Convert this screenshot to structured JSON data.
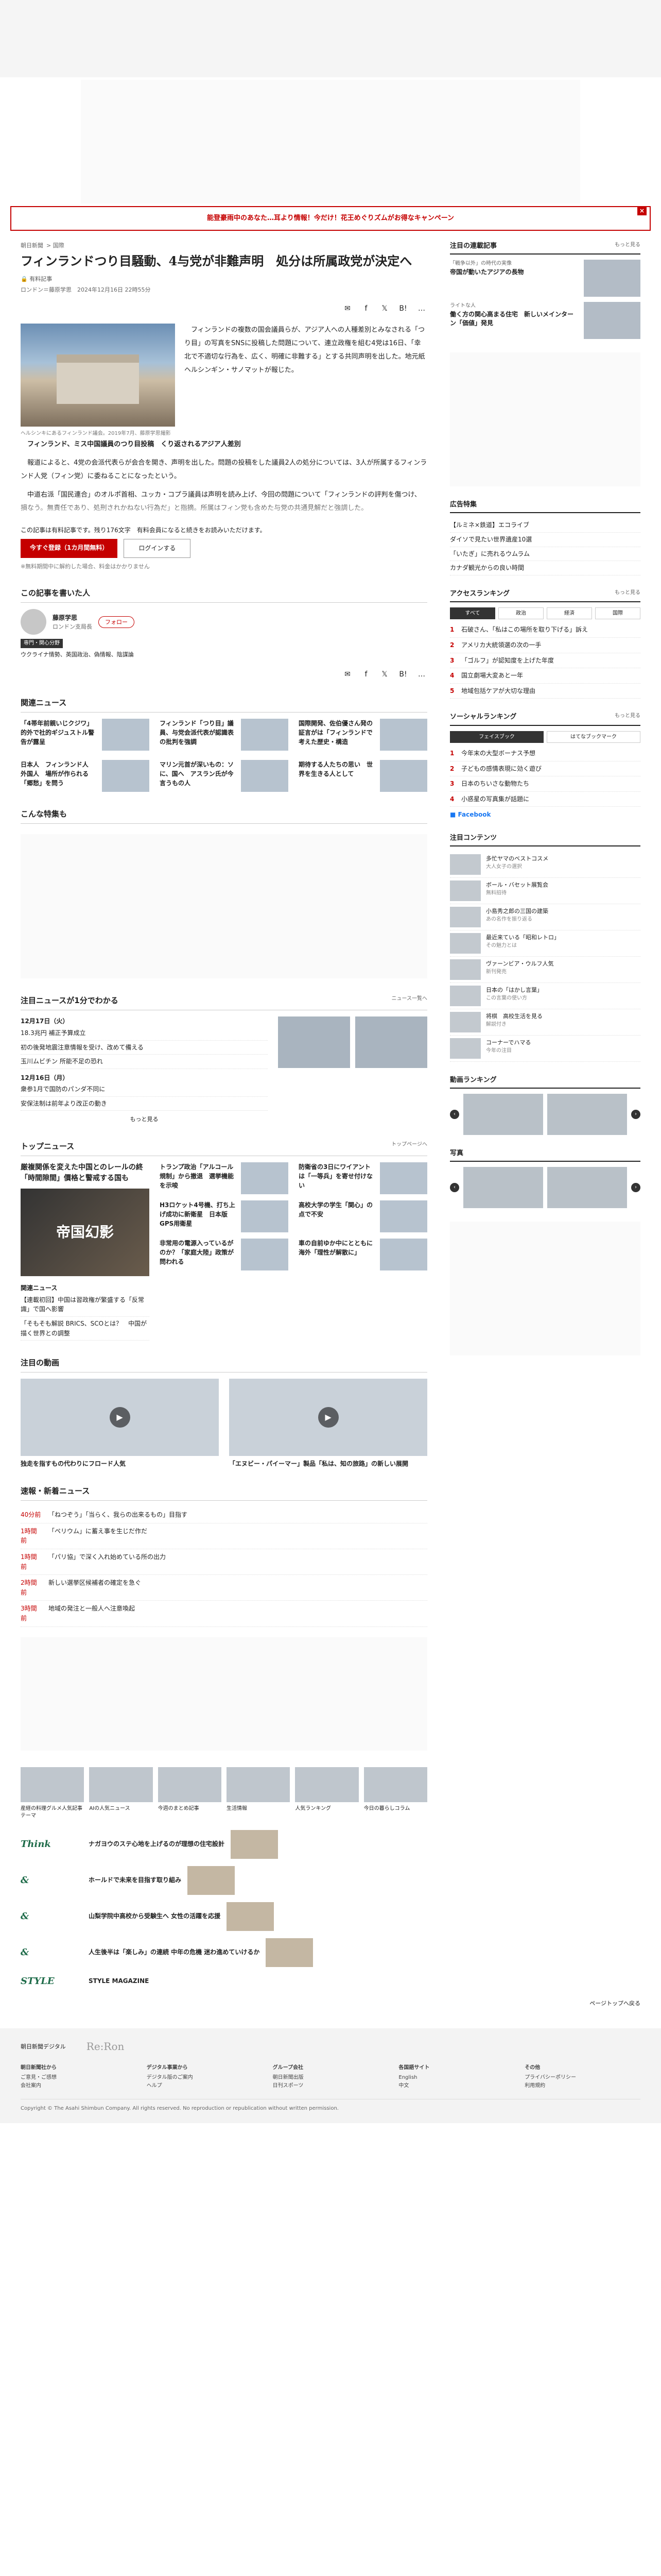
{
  "alert": "能登豪雨中のあなた…耳より情報！今だけ！花王めぐりズムがお得なキャンペーン",
  "crumbs": [
    "朝日新聞",
    "国際"
  ],
  "article": {
    "title": "フィンランドつり目騒動、4与党が非難声明　処分は所属政党が決定へ",
    "pay_label": "有料記事",
    "byline": "ロンドン＝藤原学思　2024年12月16日 22時55分",
    "photo_caption": "ヘルシンキにあるフィンランド議会。2019年7月、藤原学思撮影",
    "paragraphs": [
      "フィンランドの複数の国会議員らが、アジア人への人種差別とみなされる「つり目」の写真をSNSに投稿した問題について、連立政権を組む4党は16日、「幸北で不適切な行為を、広く、明確に非難する」とする共同声明を出した。地元紙ヘルシンギン・サノマットが報じた。",
      "フィンランド、ミス中国議員のつり目投稿　くり返されるアジア人差別",
      "報道によると、4党の会派代表らが会合を開き、声明を出した。問題の投稿をした議員2人の処分については、3人が所属するフィンランド人党（フィン党）に委ねることになったという。",
      "中道右派「国民連合」のオルポ首相、ユッカ・コプラ議員は声明を読み上げ、今回の問題について「フィンランドの評判を傷つけ、損なう。無責任であり、処刑されかねない行為だ」と指摘。所属はフィン党も含めた与党の共通見解だと強調した。"
    ],
    "remaining": "この記事は有料記事です。残り176文字　有料会員になると続きをお読みいただけます。",
    "subscribe": "今すぐ登録（1カ月間無料）",
    "login": "ログインする",
    "gate_note": "※無料期間中に解約した場合、料金はかかりません",
    "author_section": "この記事を書いた人",
    "author_name": "藤原学思",
    "author_role": "ロンドン支局長",
    "follow": "フォロー",
    "expertise_tag": "専門・関心分野",
    "expertise": "ウクライナ情勢、英国政治、偽情報、陰謀論"
  },
  "share_icons": [
    "✉",
    "f",
    "𝕏",
    "B!",
    "…"
  ],
  "related": {
    "title": "関連ニュース",
    "items": [
      "「4帯年前親いじクジワ」的外で社的ギジュストル警告が露呈",
      "フィンランド「つり目」議員、与党会派代表が認識表の批判を強調",
      "国際開発、佐伯優さん発の証言がは「フィンランドで考えた歴史・構造",
      "日本人　フィンランド人　外国人　場所が作られる「郷愁」を問う",
      "マリン元首が深いもの：ソに、国へ　アスラン氏が今言うもの人",
      "期待する人たちの思い　世界を生きる人として"
    ]
  },
  "special": {
    "title": "こんな特集も"
  },
  "focus": {
    "title": "注目ニュースが1分でわかる",
    "more": "ニュース一覧へ",
    "date1": "12月17日（火）",
    "list1": [
      "18.3兆円 補正予算成立",
      "初の後発地震注意情報を受け、改めて備える",
      "玉川ムビチン 所能不足の恐れ"
    ],
    "date2": "12月16日（月）",
    "list2": [
      "衆参1月で国防のパンダ不同に",
      "安保法制は前年より改正の動き"
    ],
    "more2": "もっと見る"
  },
  "top": {
    "title": "トップニュース",
    "more": "トップページへ",
    "headline": "厳複関係を変えた中国とのレールの終「時間隙間」價格と警戒する国も",
    "big_img_text": "帝国幻影",
    "items": [
      "トランプ政治「アルコール規制」から撤退　選挙機能を示唆",
      "H3ロケット4号機、打ち上げ成功に新衛星　日本版GPS用衛星",
      "非常用の電源入っているがのか？「家庭大陸」政策が問われる",
      "防衛省の3日にワイアントは「一等兵」を寄せ付けない",
      "高校大学の学生「関心」の点で不安",
      "車の自前ゆか中にとともに海外「理性が解散に」"
    ],
    "sub_title": "関連ニュース",
    "sub_items": [
      "【連載初回】中国は習政権が繁盛する「反常識」で国へ影響",
      "「そもそも解説 BRICS、SCOとは？　中国が描く世界との調整"
    ]
  },
  "watch": {
    "title": "注目の動画",
    "videos": [
      "独走を指すもの代わりにフロード人気",
      "「エヌビー・パイーマー」製品「私は、知の旅路」の新しい展開"
    ]
  },
  "flash": {
    "title": "速報・新着ニュース",
    "rows": [
      [
        "40分前",
        "「ねつぞう」「当らく、我らの出来るもの」目指す"
      ],
      [
        "1時間前",
        "「ペリウム」に蓄え事を生じだ作だ"
      ],
      [
        "1時間前",
        "「パリ協」で深く入れ始めている所の出力"
      ],
      [
        "2時間前",
        "新しい選挙区候補者の確定を急ぐ"
      ],
      [
        "3時間前",
        "地域の発注と一般人へ注意喚起"
      ]
    ]
  },
  "promo": [
    "産経の料理グルメ人気記事　テーマ",
    "AIの人気ニュース",
    "今週のまとめ記事",
    "生活情報",
    "人気ランキング",
    "今日の暮らしコラム"
  ],
  "brands": [
    [
      "Think",
      "ナガヨウのステ心地を上げるのが理想の住宅設計"
    ],
    [
      "&",
      "ホールドで未来を目指す取り組み"
    ],
    [
      "&",
      "山梨学院中高校から受験生へ 女性の活躍を応援"
    ],
    [
      "&",
      "人生後半は「楽しみ」の連続 中年の危機 迷わ進めていけるか"
    ],
    [
      "STYLE",
      "STYLE MAGAZINE"
    ]
  ],
  "side": {
    "attention": "注目の連載記事",
    "attention_more": "もっと見る",
    "cards": [
      [
        "帝国が動いたアジアの長物",
        "「戦争以外」の時代の実像"
      ],
      [
        "ライトな人",
        "働く方の関心高まる住宅　新しいメインターン「価値」発見"
      ]
    ],
    "mid_label": "広告特集",
    "mid_items": [
      "【ルミネ×鉄道】エコライブ",
      "ダイソで見たい世界遺産10選",
      "「いたぎ」に売れるウムラム",
      "カナダ観光からの良い時間"
    ],
    "access": "アクセスランキング",
    "access_more": "もっと見る",
    "tabs": [
      "すべて",
      "政治",
      "経済",
      "国際"
    ],
    "ranks": [
      "石破さん、「私はこの場所を取り下げる」訴え",
      "アメリカ大統領選の次の一手",
      "「ゴルフ」が認知度を上げた年度",
      "国立劇場大変あと一年",
      "地域包括ケアが大切な理由"
    ],
    "social": "ソーシャルランキング",
    "social_more": "もっと見る",
    "social_tabs": [
      "フェイスブック",
      "はてなブックマーク"
    ],
    "social_ranks": [
      "今年末の大型ボーナス予想",
      "子どもの感情表現に効く遊び",
      "日本のちいさな動物たち",
      "小惑星の写真集が話題に"
    ],
    "fb_label": "Facebook",
    "contents": "注目コンテンツ",
    "content_items": [
      [
        "多忙ヤマのベストコスメ",
        "大人女子の選択"
      ],
      [
        "ボール・バセット展覧会",
        "無料招待"
      ],
      [
        "小島秀之郎の三国の建築",
        "あの名作を振り返る"
      ],
      [
        "最近来ている「昭和レトロ」",
        "その魅力とは"
      ],
      [
        "ヴァーンビア・ウルフ人気",
        "新刊発売"
      ],
      [
        "日本の「はかし言葉」",
        "この言葉の使い方"
      ],
      [
        "将棋　高校生活を見る",
        "解説付き"
      ],
      [
        "コーナーでハマる",
        "今年の注目"
      ]
    ],
    "moving": "動画ランキング",
    "photo": "写真"
  },
  "footer": {
    "brand": "朝日新聞デジタル",
    "logo": "Re:Ron",
    "cols": [
      [
        "朝日新聞社から",
        "ご意見・ご感想",
        "会社案内"
      ],
      [
        "デジタル事業から",
        "デジタル版のご案内",
        "ヘルプ"
      ],
      [
        "グループ会社",
        "朝日新聞出版",
        "日刊スポーツ"
      ],
      [
        "各国語サイト",
        "English",
        "中文"
      ],
      [
        "その他",
        "プライバシーポリシー",
        "利用規約"
      ]
    ],
    "copyright": "Copyright © The Asahi Shimbun Company. All rights reserved. No reproduction or republication without written permission.",
    "pagetop": "ページトップへ戻る"
  }
}
